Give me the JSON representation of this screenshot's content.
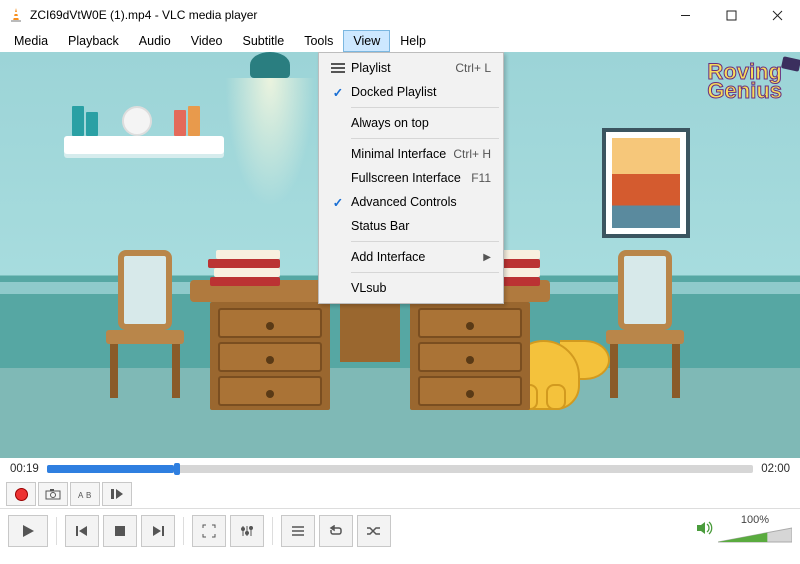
{
  "title": "ZCI69dVtW0E (1).mp4 - VLC media player",
  "menubar": [
    "Media",
    "Playback",
    "Audio",
    "Video",
    "Subtitle",
    "Tools",
    "View",
    "Help"
  ],
  "active_menu_index": 6,
  "dropdown": {
    "items": [
      {
        "label": "Playlist",
        "accel": "Ctrl+ L",
        "icon": "burger"
      },
      {
        "label": "Docked Playlist",
        "checked": true
      },
      {
        "sep": true
      },
      {
        "label": "Always on top"
      },
      {
        "sep": true
      },
      {
        "label": "Minimal Interface",
        "accel": "Ctrl+ H"
      },
      {
        "label": "Fullscreen Interface",
        "accel": "F11"
      },
      {
        "label": "Advanced Controls",
        "checked": true
      },
      {
        "label": "Status Bar"
      },
      {
        "sep": true
      },
      {
        "label": "Add Interface",
        "submenu": true
      },
      {
        "sep": true
      },
      {
        "label": "VLsub"
      }
    ]
  },
  "brand": {
    "line1": "Roving",
    "line2": "Genius"
  },
  "time": {
    "elapsed": "00:19",
    "total": "02:00",
    "progress_pct": 18
  },
  "volume": {
    "text": "100%",
    "level_pct": 100
  }
}
